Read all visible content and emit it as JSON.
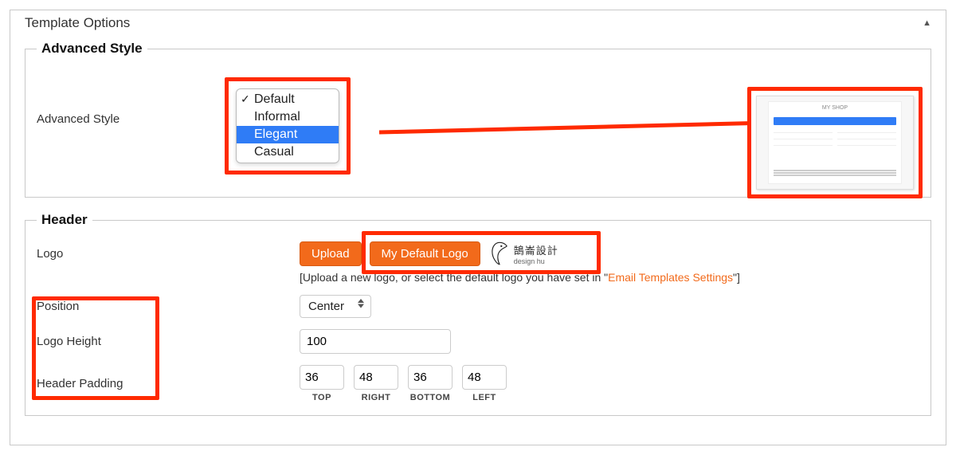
{
  "panel": {
    "title": "Template Options"
  },
  "advanced": {
    "legend": "Advanced Style",
    "label": "Advanced Style",
    "options": {
      "default": "Default",
      "informal": "Informal",
      "elegant": "Elegant",
      "casual": "Casual"
    },
    "preview_title": "MY SHOP"
  },
  "header": {
    "legend": "Header",
    "logo_label": "Logo",
    "upload_btn": "Upload",
    "default_logo_btn": "My Default Logo",
    "logo_cn": "鵠崙設計",
    "logo_en": "design hu",
    "hint_prefix": "[Upload a new logo, or select the default logo you have set in \"",
    "hint_link": "Email Templates Settings",
    "hint_suffix": "\"]",
    "position_label": "Position",
    "position_value": "Center",
    "height_label": "Logo Height",
    "height_value": "100",
    "padding_label": "Header Padding",
    "padding": {
      "top": "36",
      "right": "48",
      "bottom": "36",
      "left": "48",
      "cap_top": "TOP",
      "cap_right": "RIGHT",
      "cap_bottom": "BOTTOM",
      "cap_left": "LEFT"
    }
  },
  "colors": {
    "accent": "#f26a1b",
    "highlight": "#ff2a00",
    "select_bg": "#2f7cf6"
  }
}
